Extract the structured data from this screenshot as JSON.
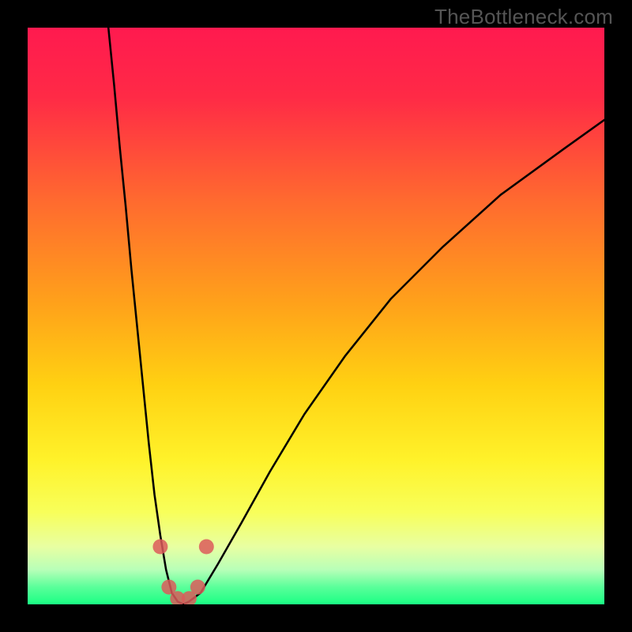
{
  "chart_data": {
    "type": "line",
    "title": "",
    "xlabel": "",
    "ylabel": "",
    "xlim": [
      0,
      100
    ],
    "ylim": [
      0,
      100
    ],
    "grid": false,
    "legend": false,
    "series": [
      {
        "name": "curve-left",
        "x": [
          14,
          15,
          16,
          17,
          18,
          19,
          20,
          21,
          22,
          23,
          24,
          25,
          26,
          27
        ],
        "y": [
          100,
          90,
          79,
          69,
          58,
          48,
          38,
          28,
          19,
          12,
          6,
          2,
          0.5,
          0
        ]
      },
      {
        "name": "curve-right",
        "x": [
          27,
          28,
          30,
          33,
          37,
          42,
          48,
          55,
          63,
          72,
          82,
          93,
          100
        ],
        "y": [
          0,
          0.5,
          2,
          7,
          14,
          23,
          33,
          43,
          53,
          62,
          71,
          79,
          84
        ]
      }
    ],
    "annotations": [
      {
        "label": "marker",
        "x": 23.0,
        "y": 10
      },
      {
        "label": "marker",
        "x": 24.5,
        "y": 3
      },
      {
        "label": "marker",
        "x": 26.0,
        "y": 1
      },
      {
        "label": "marker",
        "x": 28.0,
        "y": 1
      },
      {
        "label": "marker",
        "x": 29.5,
        "y": 3
      },
      {
        "label": "marker",
        "x": 31.0,
        "y": 10
      }
    ],
    "background_gradient": {
      "stops": [
        {
          "pos": 0.0,
          "color": "#ff1a4f"
        },
        {
          "pos": 0.12,
          "color": "#ff2a46"
        },
        {
          "pos": 0.3,
          "color": "#ff6a2f"
        },
        {
          "pos": 0.48,
          "color": "#ffa21a"
        },
        {
          "pos": 0.62,
          "color": "#ffd112"
        },
        {
          "pos": 0.75,
          "color": "#fff22a"
        },
        {
          "pos": 0.84,
          "color": "#f8ff5a"
        },
        {
          "pos": 0.9,
          "color": "#e8ffa2"
        },
        {
          "pos": 0.94,
          "color": "#b8ffb8"
        },
        {
          "pos": 0.97,
          "color": "#5aff9a"
        },
        {
          "pos": 1.0,
          "color": "#1aff84"
        }
      ]
    }
  },
  "attribution": "TheBottleneck.com"
}
